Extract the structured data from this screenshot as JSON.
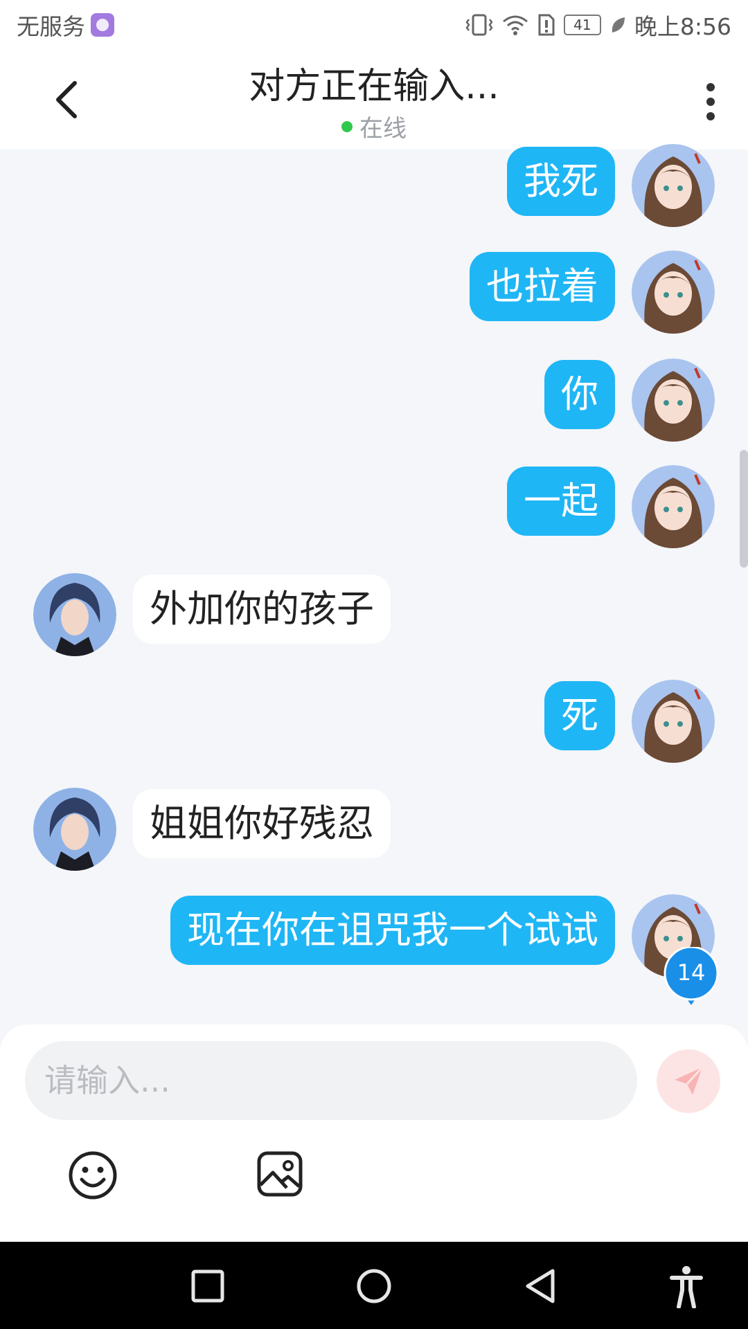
{
  "status_bar": {
    "carrier": "无服务",
    "battery": "41",
    "time": "晚上8:56"
  },
  "header": {
    "title": "对方正在输入...",
    "status": "在线"
  },
  "messages": [
    {
      "side": "out",
      "text": "我死"
    },
    {
      "side": "out",
      "text": "也拉着"
    },
    {
      "side": "out",
      "text": "你"
    },
    {
      "side": "out",
      "text": "一起"
    },
    {
      "side": "in",
      "text": "外加你的孩子"
    },
    {
      "side": "out",
      "text": "死"
    },
    {
      "side": "in",
      "text": "姐姐你好残忍"
    },
    {
      "side": "out",
      "text": "现在你在诅咒我一个试试"
    }
  ],
  "unread_badge": "14",
  "composer": {
    "placeholder": "请输入..."
  },
  "colors": {
    "outgoing_bubble": "#1fb6f5",
    "incoming_bubble": "#ffffff",
    "online_dot": "#2ec84a",
    "badge": "#1a8fe8"
  },
  "icons": [
    "back-icon",
    "more-icon",
    "send-icon",
    "emoji-icon",
    "image-icon",
    "home-square-icon",
    "home-circle-icon",
    "back-triangle-icon",
    "accessibility-icon"
  ]
}
